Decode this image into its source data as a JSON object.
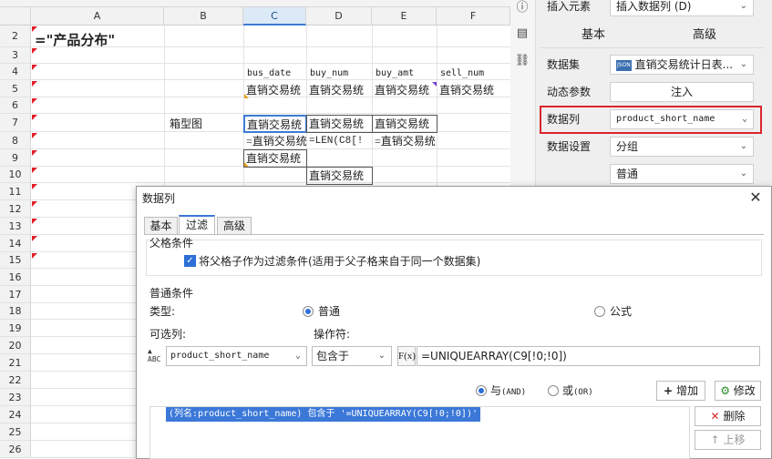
{
  "sheet": {
    "columns": [
      "A",
      "B",
      "C",
      "D",
      "E",
      "F"
    ],
    "rows": [
      "2",
      "3",
      "4",
      "5",
      "6",
      "7",
      "8",
      "9",
      "10",
      "11",
      "12",
      "13",
      "14",
      "15",
      "16",
      "17",
      "18",
      "19",
      "20",
      "21",
      "22",
      "23",
      "24",
      "25",
      "26"
    ],
    "cells": {
      "a2": "=\"产品分布\"",
      "c4": "bus_date",
      "d4": "buy_num",
      "e4": "buy_amt",
      "f4": "sell_num",
      "c5": "直销交易统",
      "d5": "直销交易统",
      "e5": "直销交易统",
      "f5": "直销交易统",
      "b7": "箱型图",
      "c7": "直销交易统",
      "d7": "直销交易统",
      "e7": "直销交易统",
      "c8": "=直销交易统",
      "d8": "=LEN(C8[!",
      "e8": "=直销交易统",
      "c9": "直销交易统",
      "d10": "直销交易统"
    }
  },
  "panel": {
    "insert_element_label": "插入元素",
    "insert_element_value": "插入数据列",
    "insert_element_shortcut": "(D)",
    "tabs": [
      "基本",
      "高级"
    ],
    "dataset_label": "数据集",
    "dataset_value": "直销交易统计日表...",
    "dataset_icon_text": "JSON",
    "dynamic_param_label": "动态参数",
    "inject_label": "注入",
    "data_column_label": "数据列",
    "data_column_value": "product_short_name",
    "data_setting_label": "数据设置",
    "data_setting_value": "分组",
    "data_setting_mode": "普通",
    "accent_color": "#d9262c"
  },
  "dialog": {
    "title": "数据列",
    "tabs": [
      "基本",
      "过滤",
      "高级"
    ],
    "parent_condition_title": "父格条件",
    "parent_checkbox_label": "将父格子作为过滤条件(适用于父子格来自于同一个数据集)",
    "normal_condition_title": "普通条件",
    "type_label": "类型:",
    "type_normal": "普通",
    "type_formula": "公式",
    "optional_column_label": "可选列:",
    "operator_label": "操作符:",
    "column_value": "product_short_name",
    "operator_value": "包含于",
    "fx_label": "F(x)",
    "formula_value": "=UNIQUEARRAY(C9[!0;!0])",
    "and_label": "与",
    "and_code": "(AND)",
    "or_label": "或",
    "or_code": "(OR)",
    "add_label": "增加",
    "modify_label": "修改",
    "delete_label": "删除",
    "up_label": "上移",
    "condition_row": "(列名:product_short_name) 包含于 '=UNIQUEARRAY(C9[!0;!0])'",
    "selection_color": "#3b78d8"
  }
}
